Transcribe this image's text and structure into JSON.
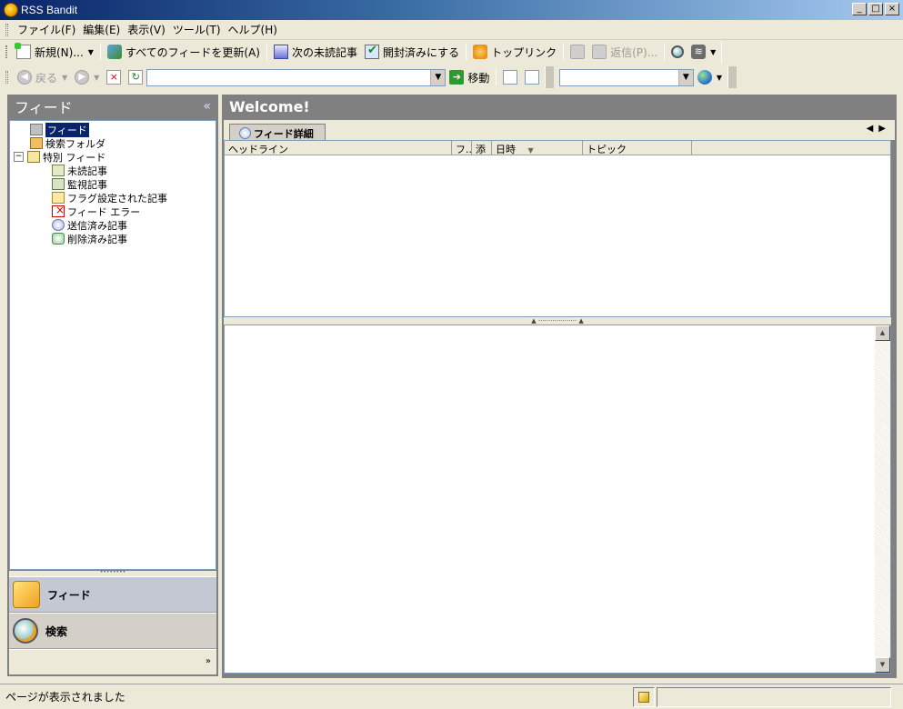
{
  "window": {
    "title": "RSS Bandit",
    "minimize": "_",
    "maximize": "□",
    "close": "×"
  },
  "menu": [
    "ファイル(F)",
    "編集(E)",
    "表示(V)",
    "ツール(T)",
    "ヘルプ(H)"
  ],
  "toolbar1": {
    "new": "新規(N)...",
    "refresh_all": "すべてのフィードを更新(A)",
    "next_unread": "次の未読記事",
    "mark_read": "開封済みにする",
    "top_links": "トップリンク",
    "reply": "返信(P)..."
  },
  "toolbar2": {
    "back": "戻る",
    "url_value": "",
    "go": "移動",
    "search_value": ""
  },
  "left_panel": {
    "title": "フィード",
    "tree": {
      "feeds": "フィード",
      "search_folders": "検索フォルダ",
      "special_feeds": "特別 フィード",
      "children": [
        "未読記事",
        "監視記事",
        "フラグ設定された記事",
        "フィード エラー",
        "送信済み記事",
        "削除済み記事"
      ]
    },
    "nav": {
      "feeds": "フィード",
      "search": "検索"
    }
  },
  "right_panel": {
    "title": "Welcome!",
    "tab": "フィード詳細",
    "columns": [
      "ヘッドライン",
      "フ..",
      "添",
      "日時",
      "トピック"
    ]
  },
  "status": {
    "text": "ページが表示されました"
  }
}
